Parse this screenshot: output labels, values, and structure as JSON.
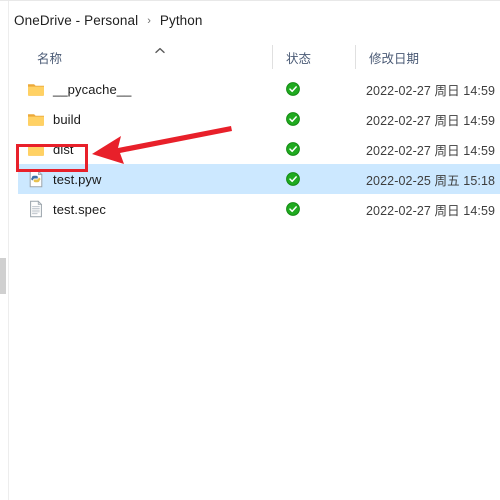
{
  "window": {
    "type": "file-explorer"
  },
  "breadcrumb": {
    "separator": "›",
    "items": [
      {
        "label": "OneDrive - Personal"
      },
      {
        "label": "Python"
      }
    ]
  },
  "columns": {
    "name": "名称",
    "status": "状态",
    "date_modified": "修改日期",
    "sort_column": "名称",
    "sort_direction": "ascending",
    "sort_indicator_icon": "chevron-up-icon"
  },
  "files": [
    {
      "name": "__pycache__",
      "icon": "folder-icon",
      "status_icon": "cloud-synced-check-icon",
      "date_modified": "2022-02-27 周日 14:59",
      "selected": false,
      "annotated": false
    },
    {
      "name": "build",
      "icon": "folder-icon",
      "status_icon": "cloud-synced-check-icon",
      "date_modified": "2022-02-27 周日 14:59",
      "selected": false,
      "annotated": false
    },
    {
      "name": "dist",
      "icon": "folder-icon",
      "status_icon": "cloud-synced-check-icon",
      "date_modified": "2022-02-27 周日 14:59",
      "selected": false,
      "annotated": true
    },
    {
      "name": "test.pyw",
      "icon": "python-file-icon",
      "status_icon": "cloud-synced-check-icon",
      "date_modified": "2022-02-25 周五 15:18",
      "selected": true,
      "annotated": false
    },
    {
      "name": "test.spec",
      "icon": "text-document-icon",
      "status_icon": "cloud-synced-check-icon",
      "date_modified": "2022-02-27 周日 14:59",
      "selected": false,
      "annotated": false
    }
  ],
  "annotations": {
    "highlight_rect": {
      "target": "dist",
      "shape": "rectangle"
    },
    "arrow": {
      "direction": "left",
      "points_to": "dist"
    }
  },
  "colors": {
    "annotation_red": "#e8202a",
    "selection_blue": "#cce8ff",
    "status_green": "#27a327",
    "folder_yellow": "#ffc845",
    "header_text": "#4a5a75"
  }
}
